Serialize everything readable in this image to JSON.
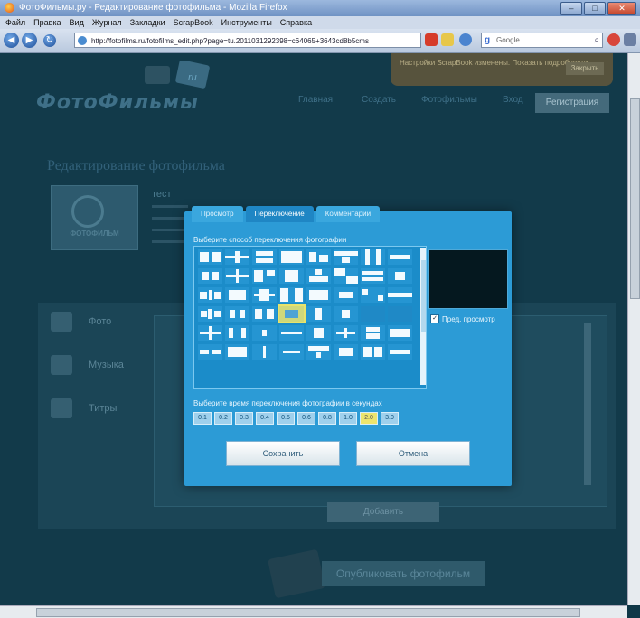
{
  "browser": {
    "title": "ФотоФильмы.ру - Редактирование фотофильма - Mozilla Firefox",
    "menu": [
      "Файл",
      "Правка",
      "Вид",
      "Журнал",
      "Закладки",
      "ScrapBook",
      "Инструменты",
      "Справка"
    ],
    "url": "http://fotofilms.ru/fotofilms_edit.php?page=tu.2011031292398=c64065+3643cd8b5cms",
    "search_placeholder": "Google"
  },
  "site": {
    "logo": "ФотоФильмы",
    "logo_badge": "ru",
    "nav": [
      "Главная",
      "Создать",
      "Фотофильмы",
      "Вход",
      "Регистрация"
    ],
    "notice_text": "Настройки ScrapBook изменены. Показать подробности...",
    "notice_button": "Закрыть"
  },
  "page": {
    "heading": "Редактирование фотофильма",
    "thumb_caption": "ФОТОФИЛЬМ",
    "film_name": "тест",
    "sidebar": [
      "Фото",
      "Музыка",
      "Титры"
    ],
    "add_button": "Добавить",
    "publish_button": "Опубликовать фотофильм"
  },
  "modal": {
    "tabs": [
      "Просмотр",
      "Переключение",
      "Комментарии"
    ],
    "active_tab": 1,
    "transition_label": "Выберите способ переключения фотографии",
    "preview_label": "Пред. просмотр",
    "time_label": "Выберите время переключения фотографии в секундах",
    "times": [
      "0.1",
      "0.2",
      "0.3",
      "0.4",
      "0.5",
      "0.6",
      "0.8",
      "1.0",
      "2.0",
      "3.0"
    ],
    "selected_time_index": 8,
    "selected_cell_index": 27,
    "save": "Сохранить",
    "cancel": "Отмена"
  },
  "colors": {
    "modal": "#2c9bd6",
    "page_bg": "#123a4a",
    "selection": "#ece46e"
  }
}
